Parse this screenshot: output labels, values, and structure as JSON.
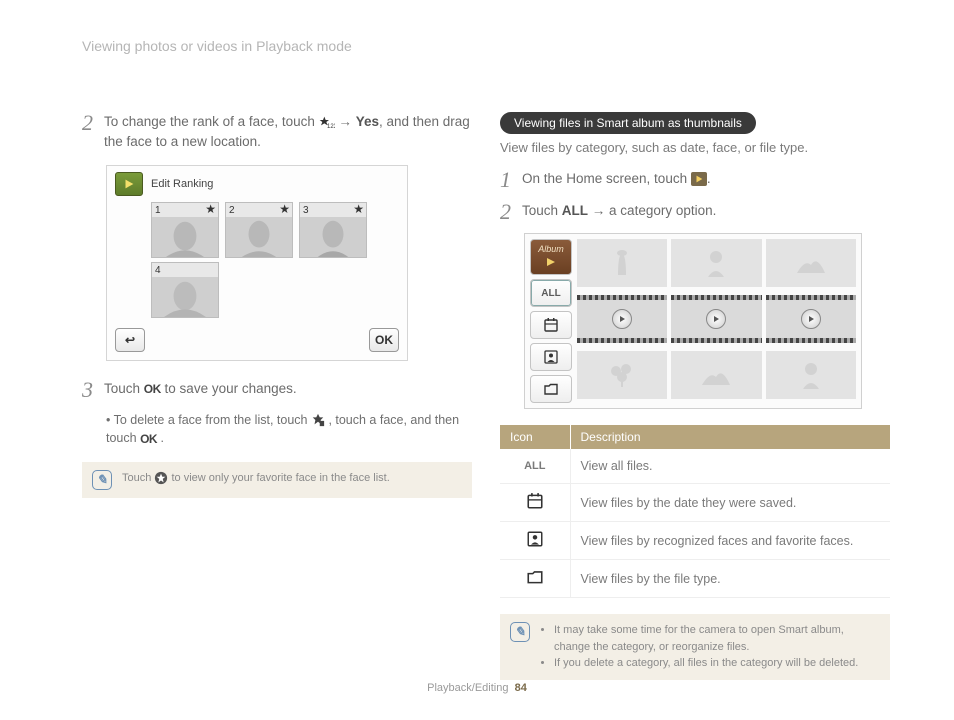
{
  "header": "Viewing photos or videos in Playback mode",
  "left": {
    "step2": {
      "pre": "To change the rank of a face, touch ",
      "mid": " → ",
      "yes": "Yes",
      "post": ", and then drag the face to a new location."
    },
    "screenshot": {
      "title": "Edit Ranking",
      "faces": [
        "1",
        "2",
        "3",
        "4"
      ],
      "back": "↩",
      "ok": "OK"
    },
    "step3": {
      "pre": "Touch ",
      "ok": "OK",
      "post": " to save your changes.",
      "bullet_pre": "To delete a face from the list, touch ",
      "bullet_mid": ", touch a face, and then touch ",
      "bullet_ok": "OK",
      "bullet_end": "."
    },
    "note": {
      "pre": "Touch ",
      "post": " to view only your favorite face in the face list."
    }
  },
  "right": {
    "pill": "Viewing files in Smart album as thumbnails",
    "intro": "View files by category, such as date, face, or file type.",
    "step1": {
      "pre": "On the Home screen, touch ",
      "post": "."
    },
    "step2": {
      "pre": "Touch ",
      "all": "ALL",
      "post": " → a category option."
    },
    "album": {
      "tab_album": "Album",
      "tab_all": "ALL"
    },
    "table": {
      "h1": "Icon",
      "h2": "Description",
      "rows": [
        {
          "icon": "ALL",
          "desc": "View all files."
        },
        {
          "icon": "calendar",
          "desc": "View files by the date they were saved."
        },
        {
          "icon": "person",
          "desc": "View files by recognized faces and favorite faces."
        },
        {
          "icon": "folder",
          "desc": "View files by the file type."
        }
      ]
    },
    "note": {
      "b1": "It may take some time for the camera to open Smart album, change the category, or reorganize files.",
      "b2": "If you delete a category, all files in the category will be deleted."
    }
  },
  "footer": {
    "section": "Playback/Editing",
    "page": "84"
  }
}
